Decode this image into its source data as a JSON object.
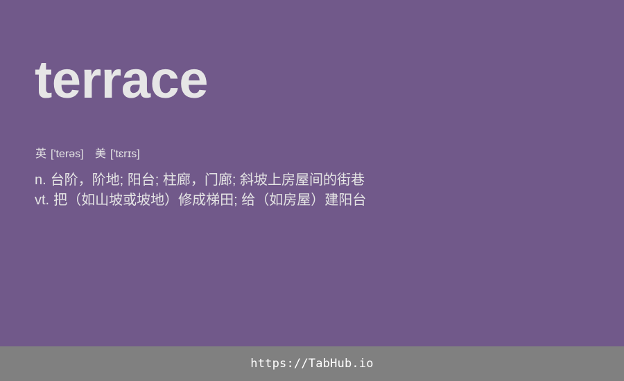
{
  "entry": {
    "word": "terrace",
    "phonetics": [
      {
        "label": "英",
        "ipa": "['terəs]"
      },
      {
        "label": "美",
        "ipa": "['tɛrɪs]"
      }
    ],
    "definitions": [
      {
        "pos": "n.",
        "text": "台阶，阶地; 阳台; 柱廊，门廊; 斜坡上房屋间的街巷"
      },
      {
        "pos": "vt.",
        "text": "把（如山坡或坡地）修成梯田; 给（如房屋）建阳台"
      }
    ]
  },
  "footer": {
    "link_text": "https://TabHub.io"
  },
  "colors": {
    "background": "#71598a",
    "footer_background": "#808080",
    "text": "#e6e6e6",
    "footer_text": "#ffffff"
  }
}
